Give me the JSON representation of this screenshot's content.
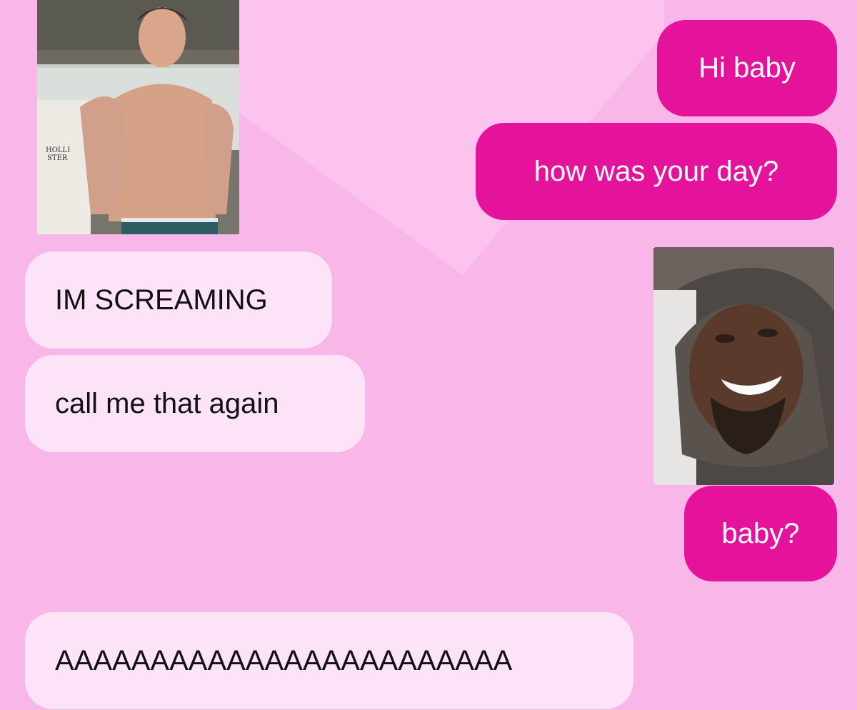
{
  "theme": {
    "background": "#f9b6e8",
    "sent_bubble": "#e5139c",
    "received_bubble": "#fde3f7"
  },
  "messages": [
    {
      "type": "image",
      "side": "left",
      "description_icon": "shirtless-man-photo"
    },
    {
      "type": "text",
      "side": "right",
      "text": "Hi baby"
    },
    {
      "type": "text",
      "side": "right",
      "text": "how was your day?"
    },
    {
      "type": "text",
      "side": "left",
      "text": "IM SCREAMING"
    },
    {
      "type": "image",
      "side": "right",
      "description_icon": "smiling-man-in-hood-photo"
    },
    {
      "type": "text",
      "side": "left",
      "text": "call me that again"
    },
    {
      "type": "text",
      "side": "right",
      "text": "baby?"
    },
    {
      "type": "text",
      "side": "left",
      "text": "AAAAAAAAAAAAAAAAAAAAAAAA"
    }
  ],
  "photo1": {
    "shirt_text_line1": "HOLLI",
    "shirt_text_line2": "STER"
  }
}
